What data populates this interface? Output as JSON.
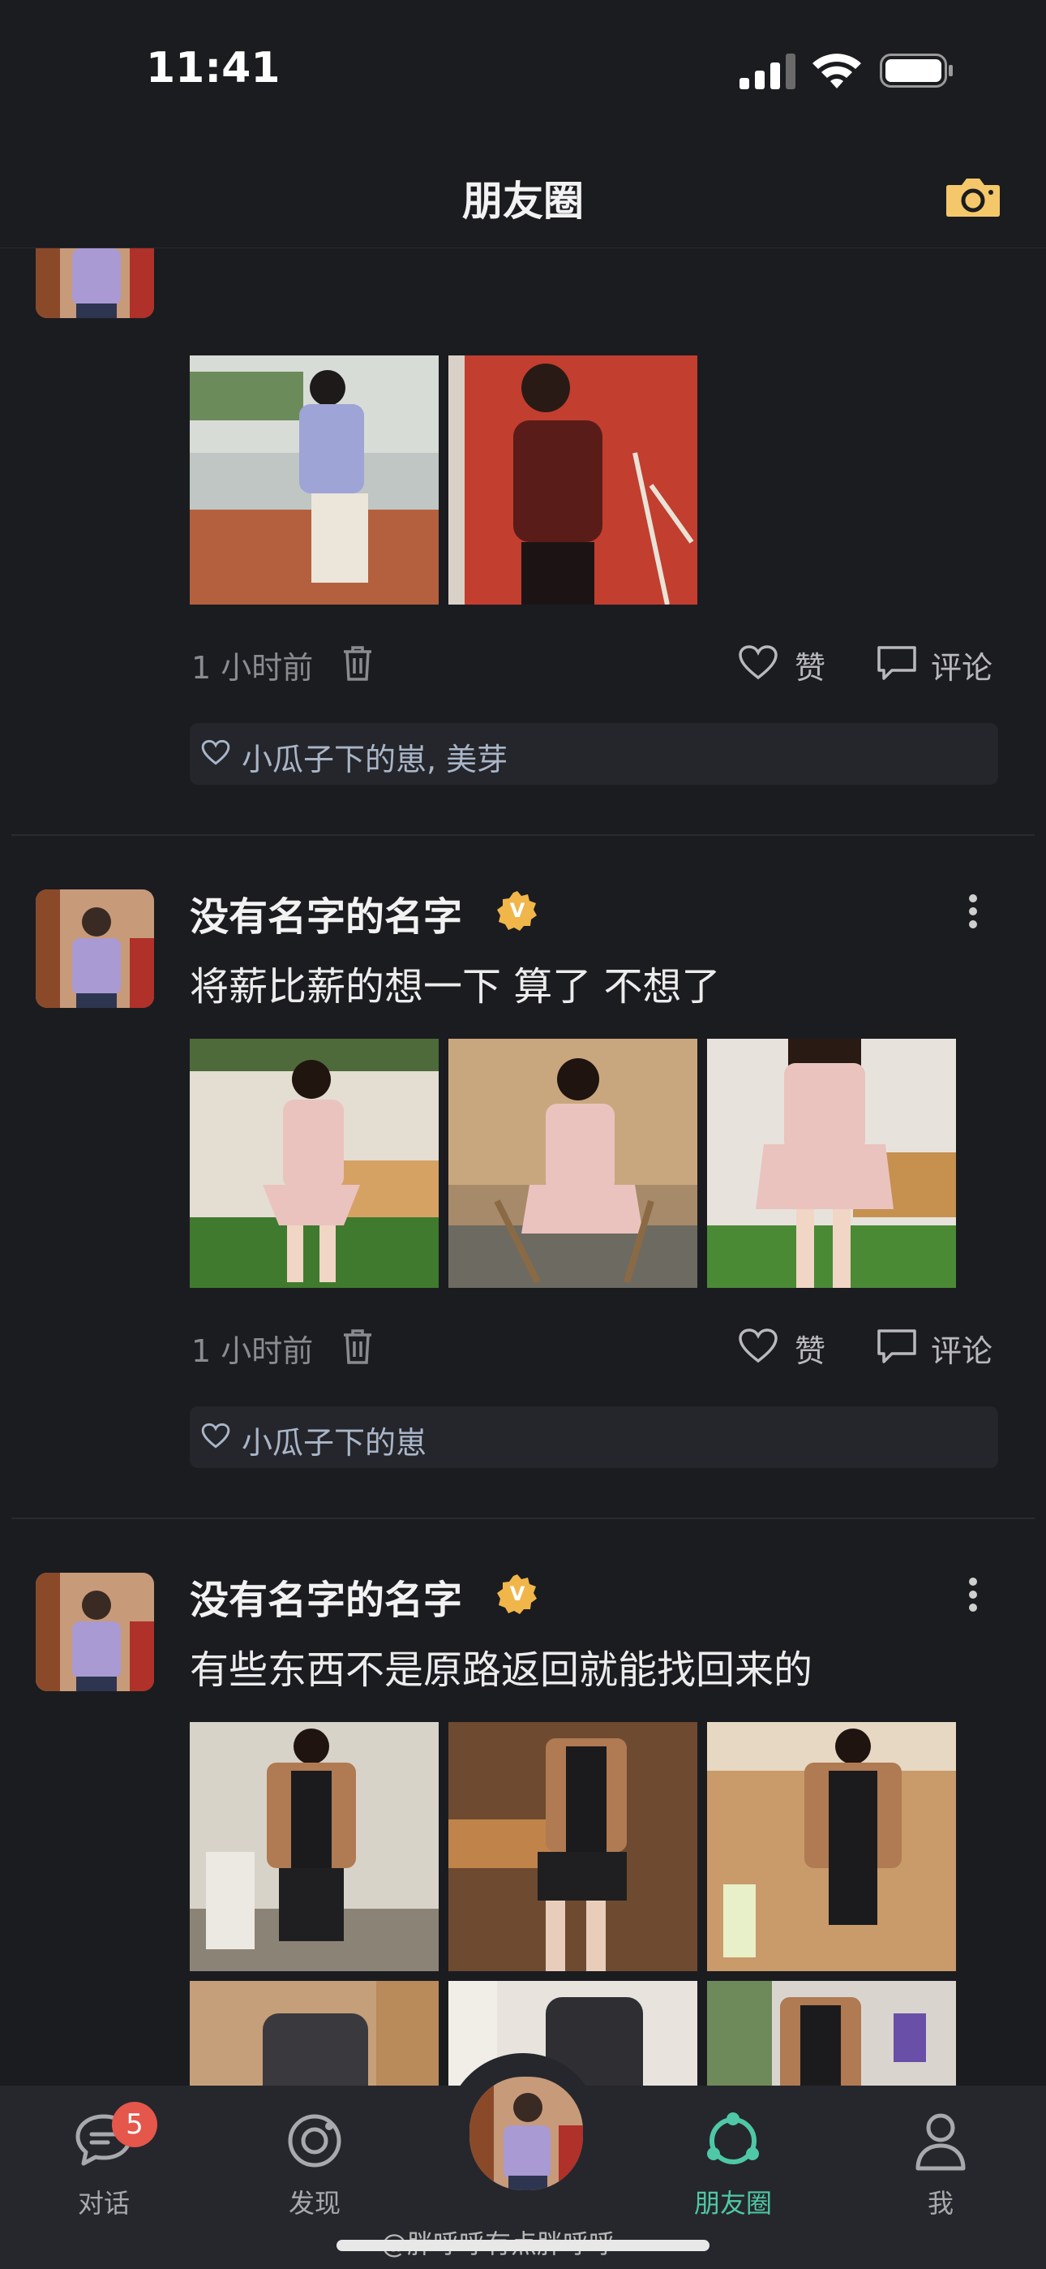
{
  "status_bar": {
    "time": "11:41"
  },
  "nav": {
    "title": "朋友圈"
  },
  "posts": [
    {
      "name": "",
      "text": "",
      "time": "1 小时前",
      "like_label": "赞",
      "comment_label": "评论",
      "likes": "小瓜子下的崽, 美芽"
    },
    {
      "name": "没有名字的名字",
      "text": "将薪比薪的想一下 算了 不想了",
      "time": "1 小时前",
      "like_label": "赞",
      "comment_label": "评论",
      "likes": "小瓜子下的崽"
    },
    {
      "name": "没有名字的名字",
      "text": "有些东西不是原路返回就能找回来的"
    }
  ],
  "tabs": [
    {
      "label": "对话",
      "badge": "5"
    },
    {
      "label": "发现"
    },
    {
      "label": "朋友圈"
    },
    {
      "label": "我"
    }
  ],
  "watermark": "@胖呼呼有点胖呼呼",
  "colors": {
    "background": "#1b1c20",
    "accent": "#4ec8a6",
    "badge": "#e5564b",
    "camera": "#f4c86a",
    "verified": "#f0b64a",
    "likes_text": "#a9b6c9"
  }
}
